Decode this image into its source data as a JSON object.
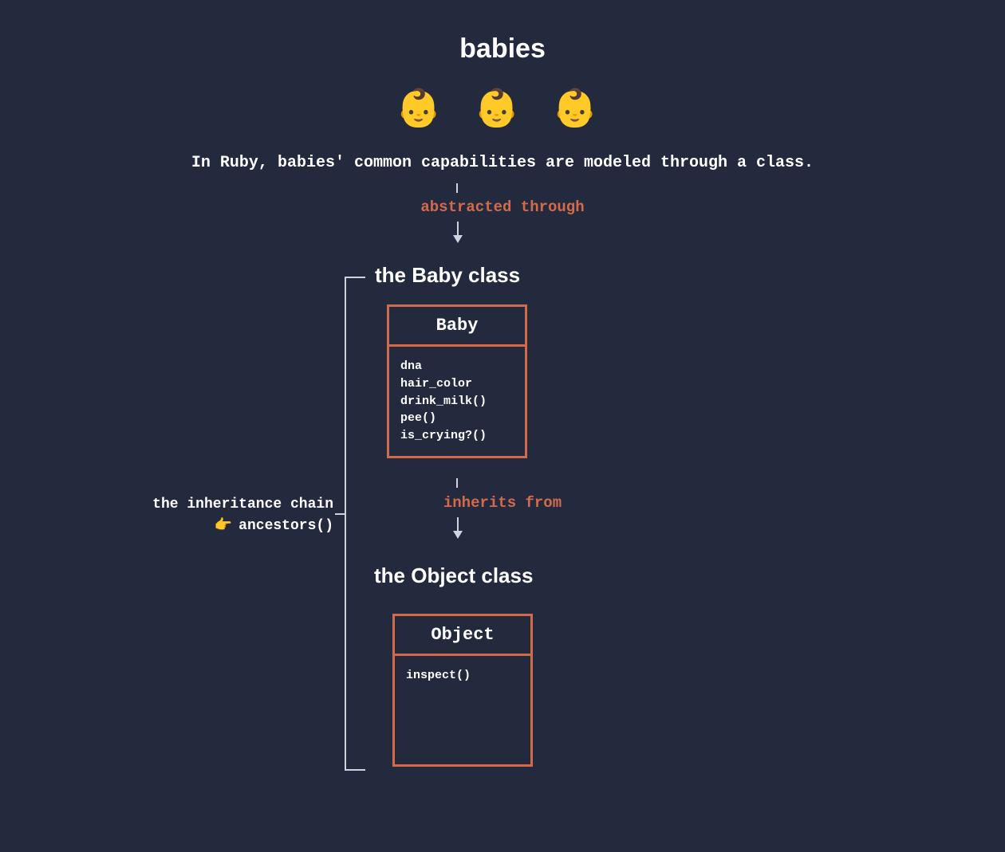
{
  "title": "babies",
  "emoji_row": "👶 👶 👶",
  "subtitle": "In Ruby, babies' common capabilities are modeled through a class.",
  "arrow_labels": {
    "abstracted": "abstracted through",
    "inherits": "inherits from"
  },
  "sections": {
    "baby_heading": "the Baby class",
    "object_heading": "the Object class"
  },
  "class_boxes": {
    "baby": {
      "name": "Baby",
      "members": [
        "dna",
        "hair_color",
        "drink_milk()",
        "pee()",
        "is_crying?()"
      ]
    },
    "object": {
      "name": "Object",
      "members": [
        "inspect()"
      ]
    }
  },
  "inheritance_note": {
    "line1": "the inheritance chain",
    "pointer_emoji": "👉",
    "method": "ancestors()"
  }
}
